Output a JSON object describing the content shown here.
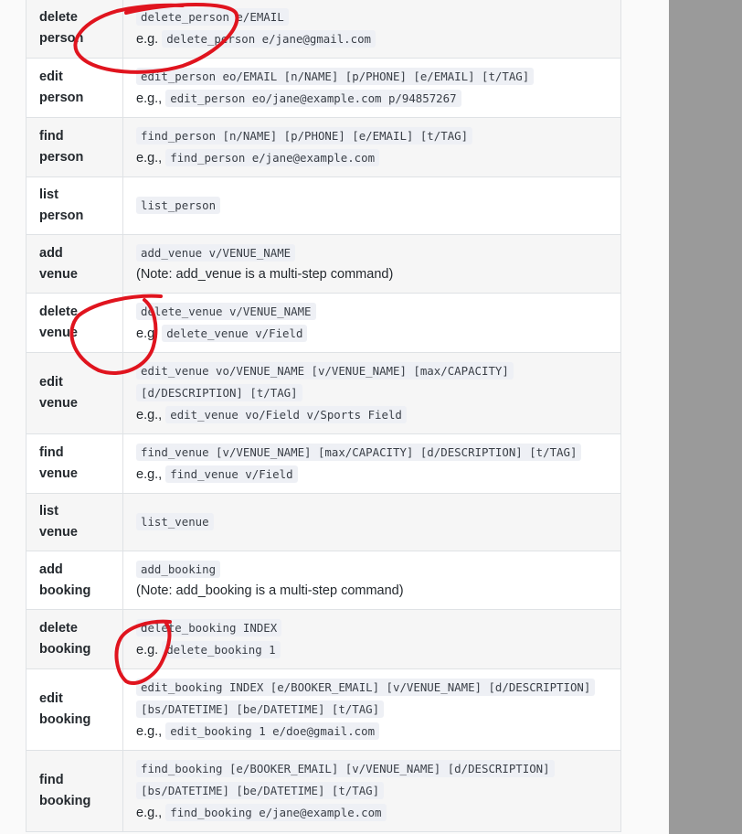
{
  "rows": [
    {
      "action": [
        "delete",
        "person"
      ],
      "format": [
        {
          "code": "delete_person e/EMAIL"
        }
      ],
      "example": {
        "prefix": "e.g.",
        "code": "delete_person e/jane@gmail.com"
      }
    },
    {
      "action": [
        "edit",
        "person"
      ],
      "format": [
        {
          "code": "edit_person eo/EMAIL [n/NAME] [p/PHONE] [e/EMAIL] [t/TAG]"
        }
      ],
      "example": {
        "prefix": "e.g.,",
        "code": "edit_person eo/jane@example.com p/94857267"
      }
    },
    {
      "action": [
        "find",
        "person"
      ],
      "format": [
        {
          "code": "find_person [n/NAME] [p/PHONE] [e/EMAIL] [t/TAG]"
        }
      ],
      "example": {
        "prefix": "e.g.,",
        "code": "find_person e/jane@example.com"
      }
    },
    {
      "action": [
        "list",
        "person"
      ],
      "format": [
        {
          "code": "list_person"
        }
      ]
    },
    {
      "action": [
        "add",
        "venue"
      ],
      "format": [
        {
          "code": "add_venue v/VENUE_NAME"
        }
      ],
      "note": "(Note: add_venue is a multi-step command)"
    },
    {
      "action": [
        "delete",
        "venue"
      ],
      "format": [
        {
          "code": "delete_venue v/VENUE_NAME"
        }
      ],
      "example": {
        "prefix": "e.g.",
        "code": "delete_venue v/Field"
      }
    },
    {
      "action": [
        "edit",
        "venue"
      ],
      "format": [
        {
          "code": "edit_venue vo/VENUE_NAME [v/VENUE_NAME] [max/CAPACITY]"
        },
        {
          "code": "[d/DESCRIPTION] [t/TAG]"
        }
      ],
      "example": {
        "prefix": "e.g.,",
        "code": "edit_venue vo/Field v/Sports Field"
      }
    },
    {
      "action": [
        "find",
        "venue"
      ],
      "format": [
        {
          "code": "find_venue [v/VENUE_NAME] [max/CAPACITY] [d/DESCRIPTION] [t/TAG]"
        }
      ],
      "example": {
        "prefix": "e.g.,",
        "code": "find_venue v/Field"
      }
    },
    {
      "action": [
        "list",
        "venue"
      ],
      "format": [
        {
          "code": "list_venue"
        }
      ]
    },
    {
      "action": [
        "add",
        "booking"
      ],
      "format": [
        {
          "code": "add_booking"
        }
      ],
      "note": "(Note: add_booking is a multi-step command)"
    },
    {
      "action": [
        "delete",
        "booking"
      ],
      "format": [
        {
          "code": "delete_booking INDEX"
        }
      ],
      "example": {
        "prefix": "e.g.",
        "code": "delete_booking 1"
      }
    },
    {
      "action": [
        "edit",
        "booking"
      ],
      "format": [
        {
          "code": "edit_booking INDEX [e/BOOKER_EMAIL] [v/VENUE_NAME] [d/DESCRIPTION]"
        },
        {
          "code": "[bs/DATETIME] [be/DATETIME] [t/TAG]"
        }
      ],
      "example": {
        "prefix": "e.g.,",
        "code": "edit_booking 1 e/doe@gmail.com"
      }
    },
    {
      "action": [
        "find",
        "booking"
      ],
      "format": [
        {
          "code": "find_booking [e/BOOKER_EMAIL] [v/VENUE_NAME] [d/DESCRIPTION]"
        },
        {
          "code": "[bs/DATETIME] [be/DATETIME] [t/TAG]"
        }
      ],
      "example": {
        "prefix": "e.g.,",
        "code": "find_booking e/jane@example.com"
      }
    }
  ],
  "colors": {
    "annotation": "#e0141e",
    "gutter": "#9a9a9a",
    "code_bg": "#eef0f5"
  },
  "annotations": [
    "red-circle-delete-person",
    "red-circle-delete-venue",
    "red-circle-delete-booking"
  ]
}
